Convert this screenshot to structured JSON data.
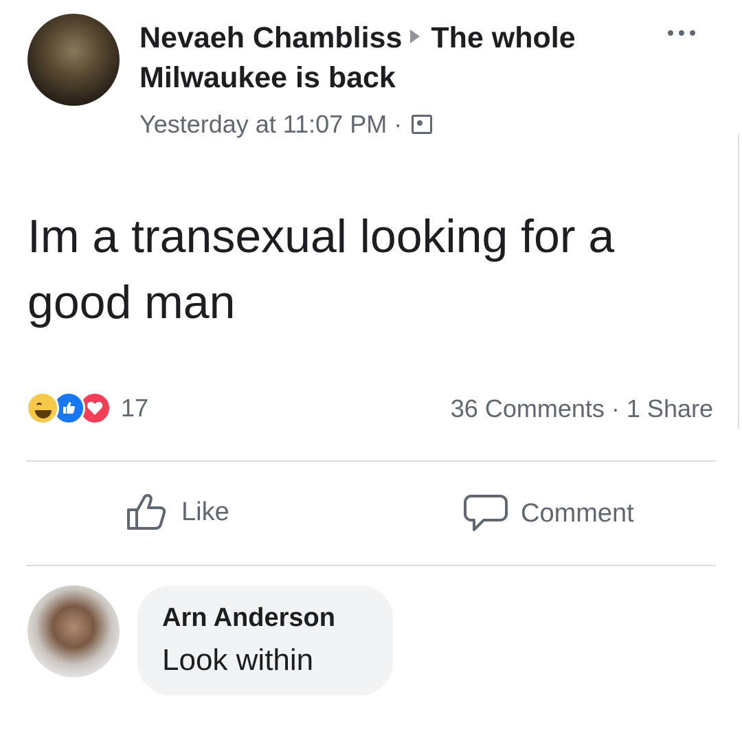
{
  "post": {
    "author": "Nevaeh Chambliss",
    "group": "The whole Milwaukee is back",
    "timestamp": "Yesterday at 11:07 PM",
    "separator": "·",
    "text": "Im a transexual looking for a good man",
    "reaction_count": "17",
    "comments_count": "36 Comments",
    "shares_count": "1 Share",
    "reactions": [
      "haha",
      "like",
      "love"
    ]
  },
  "actions": {
    "like_label": "Like",
    "comment_label": "Comment"
  },
  "comment": {
    "author": "Arn Anderson",
    "text": "Look within"
  },
  "icons": {
    "more": "more-options-icon",
    "audience": "group-audience-icon",
    "like": "thumbs-up-icon",
    "comment": "speech-bubble-icon"
  },
  "colors": {
    "text_primary": "#1c1e21",
    "text_secondary": "#616770",
    "like_blue": "#1877f2",
    "love_red": "#f33e58",
    "haha_yellow": "#f7c94a",
    "bubble_bg": "#f2f3f5"
  }
}
